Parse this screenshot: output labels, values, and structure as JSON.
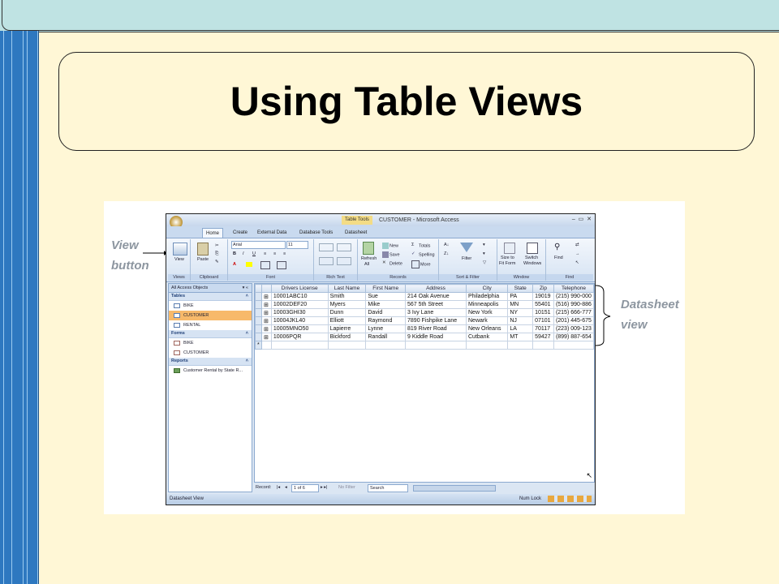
{
  "slide": {
    "title": "Using Table Views"
  },
  "callouts": {
    "view_button": [
      "View",
      "button"
    ],
    "datasheet_view": [
      "Datasheet",
      "view"
    ]
  },
  "app": {
    "table_tools": "Table Tools",
    "title": "CUSTOMER - Microsoft Access",
    "win_controls": [
      "–",
      "▭",
      "✕"
    ],
    "tabs": [
      "Home",
      "Create",
      "External Data",
      "Database Tools",
      "Datasheet"
    ],
    "ribbon": {
      "groups": [
        "Views",
        "Clipboard",
        "Font",
        "Rich Text",
        "Records",
        "Sort & Filter",
        "Window",
        "Find"
      ],
      "view": "View",
      "paste": "Paste",
      "font_name": "Arial",
      "font_size": "11",
      "refresh": "Refresh",
      "refresh2": "All",
      "new": "New",
      "save": "Save",
      "delete": "Delete",
      "totals": "Totals",
      "spelling": "Spelling",
      "more": "More",
      "filter": "Filter",
      "size_to": "Size to",
      "fit_form": "Fit Form",
      "switch": "Switch",
      "windows": "Windows",
      "find": "Find"
    },
    "nav": {
      "header": "All Access Objects",
      "tables_label": "Tables",
      "tables": [
        "BIKE",
        "CUSTOMER",
        "RENTAL"
      ],
      "forms_label": "Forms",
      "forms": [
        "BIKE",
        "CUSTOMER"
      ],
      "reports_label": "Reports",
      "reports": [
        "Customer Rental by State R..."
      ]
    },
    "grid": {
      "columns": [
        "Drivers License",
        "Last Name",
        "First Name",
        "Address",
        "City",
        "State",
        "Zip",
        "Telephone"
      ],
      "rows": [
        [
          "10001ABC10",
          "Smith",
          "Sue",
          "214 Oak Avenue",
          "Philadelphia",
          "PA",
          "19019",
          "(215) 990-000"
        ],
        [
          "10002DEF20",
          "Myers",
          "Mike",
          "567 5th Street",
          "Minneapolis",
          "MN",
          "55401",
          "(516) 990-886"
        ],
        [
          "10003GHI30",
          "Dunn",
          "David",
          "3 Ivy Lane",
          "New York",
          "NY",
          "10151",
          "(215) 666-777"
        ],
        [
          "10004JKL40",
          "Elliott",
          "Raymond",
          "7890 Fishpike Lane",
          "Newark",
          "NJ",
          "07101",
          "(201) 445-675"
        ],
        [
          "10005MNO50",
          "Lapierre",
          "Lynne",
          "819 River Road",
          "New Orleans",
          "LA",
          "70117",
          "(223) 009-123"
        ],
        [
          "10006PQR",
          "Bickford",
          "Randall",
          "9 Kiddle Road",
          "Cutbank",
          "MT",
          "59427",
          "(899) 887-654"
        ]
      ],
      "new_row_marker": "*"
    },
    "record_bar": {
      "label": "Record:",
      "position": "1 of 6",
      "no_filter": "No Filter",
      "search": "Search"
    },
    "status": {
      "left": "Datasheet View",
      "right": "Num Lock"
    }
  }
}
